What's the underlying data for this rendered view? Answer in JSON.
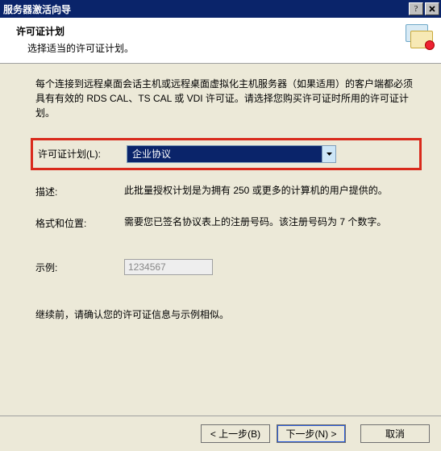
{
  "window": {
    "title": "服务器激活向导"
  },
  "header": {
    "title": "许可证计划",
    "subtitle": "选择适当的许可证计划。"
  },
  "intro": "每个连接到远程桌面会话主机或远程桌面虚拟化主机服务器（如果适用）的客户端都必须具有有效的 RDS CAL、TS CAL 或 VDI 许可证。请选择您购买许可证时所用的许可证计划。",
  "fields": {
    "plan_label": "许可证计划(L):",
    "plan_value": "企业协议",
    "desc_label": "描述:",
    "desc_value": "此批量授权计划是为拥有 250 或更多的计算机的用户提供的。",
    "fmt_label": "格式和位置:",
    "fmt_value": "需要您已签名协议表上的注册号码。该注册号码为 7 个数字。",
    "example_label": "示例:",
    "example_value": "1234567"
  },
  "confirm_note": "继续前，请确认您的许可证信息与示例相似。",
  "buttons": {
    "back": "< 上一步(B)",
    "next": "下一步(N) >",
    "cancel": "取消"
  }
}
